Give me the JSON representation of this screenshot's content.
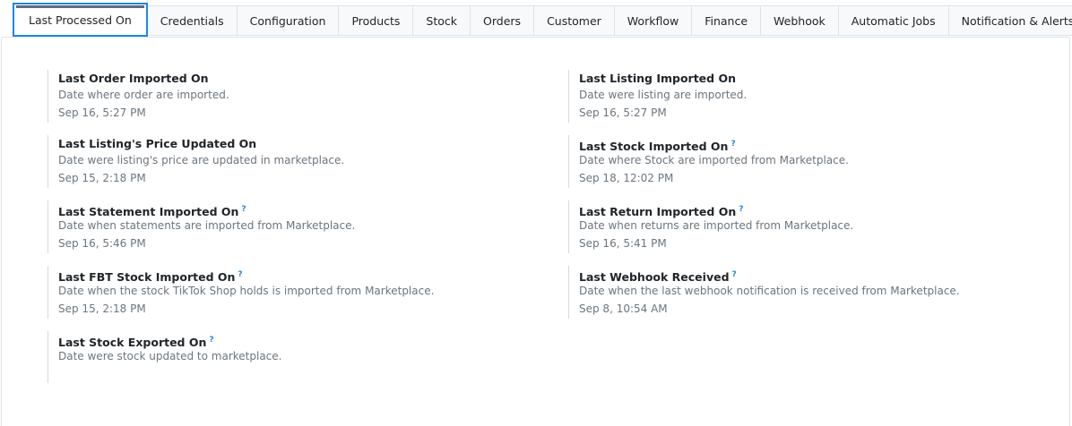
{
  "tabs": [
    {
      "label": "Last Processed On",
      "active": true
    },
    {
      "label": "Credentials"
    },
    {
      "label": "Configuration"
    },
    {
      "label": "Products"
    },
    {
      "label": "Stock"
    },
    {
      "label": "Orders"
    },
    {
      "label": "Customer"
    },
    {
      "label": "Workflow"
    },
    {
      "label": "Finance"
    },
    {
      "label": "Webhook"
    },
    {
      "label": "Automatic Jobs"
    },
    {
      "label": "Notification & Alerts"
    }
  ],
  "left_items": [
    {
      "title": "Last Order Imported On",
      "help": false,
      "desc": "Date where order are imported.",
      "value": "Sep 16, 5:27 PM"
    },
    {
      "title": "Last Listing's Price Updated On",
      "help": false,
      "desc": "Date were listing's price are updated in marketplace.",
      "value": "Sep 15, 2:18 PM"
    },
    {
      "title": "Last Statement Imported On",
      "help": true,
      "desc": "Date when statements are imported from Marketplace.",
      "value": "Sep 16, 5:46 PM"
    },
    {
      "title": "Last FBT Stock Imported On",
      "help": true,
      "desc": "Date when the stock TikTok Shop holds is imported from Marketplace.",
      "value": "Sep 15, 2:18 PM"
    },
    {
      "title": "Last Stock Exported On",
      "help": true,
      "desc": "Date were stock updated to marketplace.",
      "value": ""
    }
  ],
  "right_items": [
    {
      "title": "Last Listing Imported On",
      "help": false,
      "desc": "Date were listing are imported.",
      "value": "Sep 16, 5:27 PM"
    },
    {
      "title": "Last Stock Imported On",
      "help": true,
      "desc": "Date where Stock are imported from Marketplace.",
      "value": "Sep 18, 12:02 PM"
    },
    {
      "title": "Last Return Imported On",
      "help": true,
      "desc": "Date when returns are imported from Marketplace.",
      "value": "Sep 16, 5:41 PM"
    },
    {
      "title": "Last Webhook Received",
      "help": true,
      "desc": "Date when the last webhook notification is received from Marketplace.",
      "value": "Sep 8, 10:54 AM"
    }
  ],
  "help_glyph": "?",
  "colors": {
    "active_tab_border": "#1e88e5",
    "help_icon": "#1e88e5",
    "muted_text": "#6c757d"
  }
}
